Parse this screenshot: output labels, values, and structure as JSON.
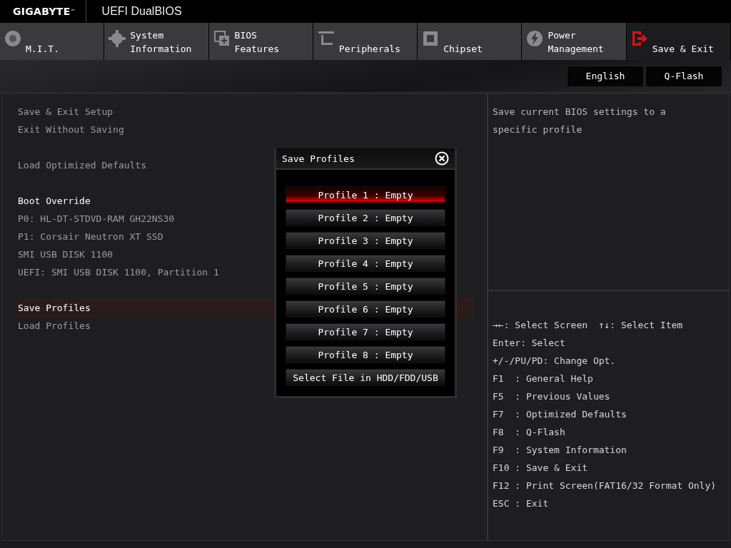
{
  "header": {
    "brand": "GIGABYTE",
    "brand_mark": "™",
    "title": "UEFI DualBIOS"
  },
  "tabs": [
    {
      "label": "M.I.T.",
      "selected": false
    },
    {
      "label": "System\nInformation",
      "selected": false
    },
    {
      "label": "BIOS\nFeatures",
      "selected": false
    },
    {
      "label": "Peripherals",
      "selected": false
    },
    {
      "label": "Chipset",
      "selected": false
    },
    {
      "label": "Power\nManagement",
      "selected": false
    },
    {
      "label": "Save & Exit",
      "selected": true
    }
  ],
  "toolbar_buttons": [
    "English",
    "Q-Flash"
  ],
  "menu_groups": [
    [
      {
        "label": "Save & Exit Setup",
        "kind": "item",
        "selected": false
      },
      {
        "label": "Exit Without Saving",
        "kind": "item",
        "selected": false
      }
    ],
    [
      {
        "label": "Load Optimized Defaults",
        "kind": "item",
        "selected": false
      }
    ],
    [
      {
        "label": "Boot Override",
        "kind": "heading",
        "selected": false
      },
      {
        "label": "P0: HL-DT-STDVD-RAM GH22NS30",
        "kind": "item",
        "selected": false
      },
      {
        "label": "P1: Corsair Neutron XT SSD",
        "kind": "item",
        "selected": false
      },
      {
        "label": "SMI USB DISK 1100",
        "kind": "item",
        "selected": false
      },
      {
        "label": "UEFI: SMI USB DISK 1100, Partition 1",
        "kind": "item",
        "selected": false
      }
    ],
    [
      {
        "label": "Save Profiles",
        "kind": "item",
        "selected": true
      },
      {
        "label": "Load Profiles",
        "kind": "item",
        "selected": false
      }
    ]
  ],
  "help_text": "Save current BIOS settings to a specific profile",
  "key_help": [
    "→←: Select Screen  ↑↓: Select Item",
    "Enter: Select",
    "+/-/PU/PD: Change Opt.",
    "F1  : General Help",
    "F5  : Previous Values",
    "F7  : Optimized Defaults",
    "F8  : Q-Flash",
    "F9  : System Information",
    "F10 : Save & Exit",
    "F12 : Print Screen(FAT16/32 Format Only)",
    "ESC : Exit"
  ],
  "dialog": {
    "title": "Save Profiles",
    "options": [
      {
        "label": "Profile 1 : Empty",
        "selected": true
      },
      {
        "label": "Profile 2 : Empty",
        "selected": false
      },
      {
        "label": "Profile 3 : Empty",
        "selected": false
      },
      {
        "label": "Profile 4 : Empty",
        "selected": false
      },
      {
        "label": "Profile 5 : Empty",
        "selected": false
      },
      {
        "label": "Profile 6 : Empty",
        "selected": false
      },
      {
        "label": "Profile 7 : Empty",
        "selected": false
      },
      {
        "label": "Profile 8 : Empty",
        "selected": false
      },
      {
        "label": "Select File in HDD/FDD/USB",
        "selected": false
      }
    ]
  }
}
